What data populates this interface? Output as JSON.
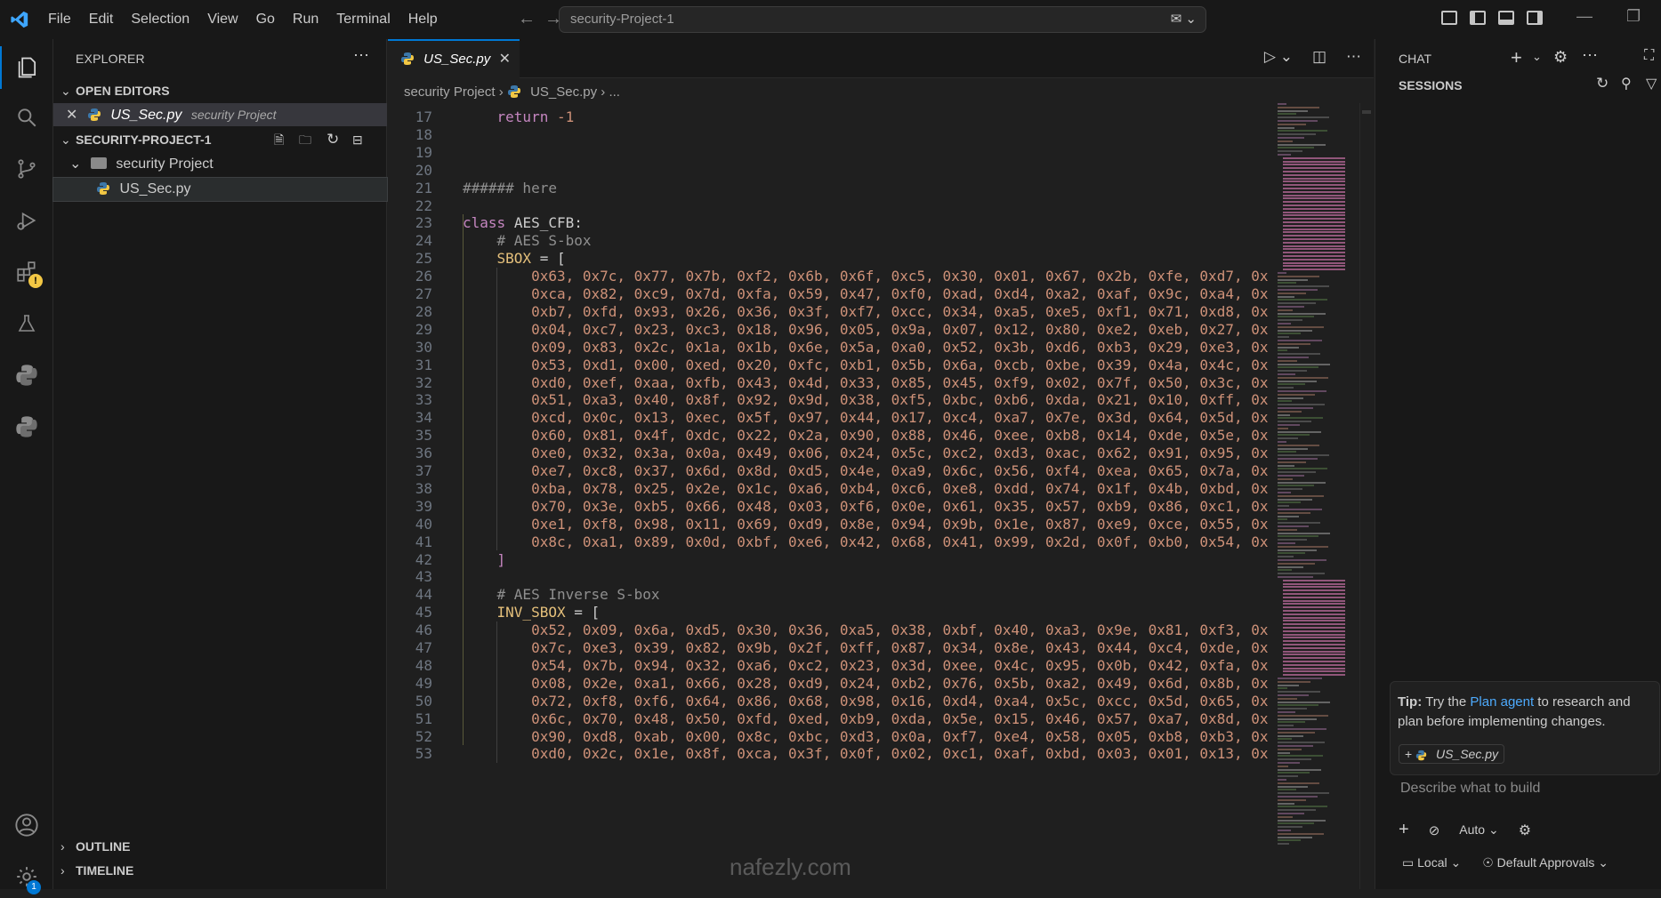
{
  "menu": [
    "File",
    "Edit",
    "Selection",
    "View",
    "Go",
    "Run",
    "Terminal",
    "Help"
  ],
  "command_center": "security-Project-1",
  "explorer": {
    "title": "EXPLORER",
    "open_editors_label": "OPEN EDITORS",
    "open_editor_file": "US_Sec.py",
    "open_editor_folder": "security Project",
    "project_label": "SECURITY-PROJECT-1",
    "folder_name": "security Project",
    "file_name": "US_Sec.py",
    "outline_label": "OUTLINE",
    "timeline_label": "TIMELINE"
  },
  "editor": {
    "tab_label": "US_Sec.py",
    "breadcrumb_folder": "security Project",
    "breadcrumb_file": "US_Sec.py",
    "breadcrumb_more": "...",
    "lines": [
      {
        "n": "17",
        "t": "return_neg"
      },
      {
        "n": "18",
        "t": "blank"
      },
      {
        "n": "19",
        "t": "blank"
      },
      {
        "n": "20",
        "t": "blank"
      },
      {
        "n": "21",
        "t": "comment_here"
      },
      {
        "n": "22",
        "t": "blank"
      },
      {
        "n": "23",
        "t": "class"
      },
      {
        "n": "24",
        "t": "comment_sbox"
      },
      {
        "n": "25",
        "t": "sbox_open"
      },
      {
        "n": "26",
        "t": "hex",
        "v": "0x63, 0x7c, 0x77, 0x7b, 0xf2, 0x6b, 0x6f, 0xc5, 0x30, 0x01, 0x67, 0x2b, 0xfe, 0xd7, 0x"
      },
      {
        "n": "27",
        "t": "hex",
        "v": "0xca, 0x82, 0xc9, 0x7d, 0xfa, 0x59, 0x47, 0xf0, 0xad, 0xd4, 0xa2, 0xaf, 0x9c, 0xa4, 0x"
      },
      {
        "n": "28",
        "t": "hex",
        "v": "0xb7, 0xfd, 0x93, 0x26, 0x36, 0x3f, 0xf7, 0xcc, 0x34, 0xa5, 0xe5, 0xf1, 0x71, 0xd8, 0x"
      },
      {
        "n": "29",
        "t": "hex",
        "v": "0x04, 0xc7, 0x23, 0xc3, 0x18, 0x96, 0x05, 0x9a, 0x07, 0x12, 0x80, 0xe2, 0xeb, 0x27, 0x"
      },
      {
        "n": "30",
        "t": "hex",
        "v": "0x09, 0x83, 0x2c, 0x1a, 0x1b, 0x6e, 0x5a, 0xa0, 0x52, 0x3b, 0xd6, 0xb3, 0x29, 0xe3, 0x"
      },
      {
        "n": "31",
        "t": "hex",
        "v": "0x53, 0xd1, 0x00, 0xed, 0x20, 0xfc, 0xb1, 0x5b, 0x6a, 0xcb, 0xbe, 0x39, 0x4a, 0x4c, 0x"
      },
      {
        "n": "32",
        "t": "hex",
        "v": "0xd0, 0xef, 0xaa, 0xfb, 0x43, 0x4d, 0x33, 0x85, 0x45, 0xf9, 0x02, 0x7f, 0x50, 0x3c, 0x"
      },
      {
        "n": "33",
        "t": "hex",
        "v": "0x51, 0xa3, 0x40, 0x8f, 0x92, 0x9d, 0x38, 0xf5, 0xbc, 0xb6, 0xda, 0x21, 0x10, 0xff, 0x"
      },
      {
        "n": "34",
        "t": "hex",
        "v": "0xcd, 0x0c, 0x13, 0xec, 0x5f, 0x97, 0x44, 0x17, 0xc4, 0xa7, 0x7e, 0x3d, 0x64, 0x5d, 0x"
      },
      {
        "n": "35",
        "t": "hex",
        "v": "0x60, 0x81, 0x4f, 0xdc, 0x22, 0x2a, 0x90, 0x88, 0x46, 0xee, 0xb8, 0x14, 0xde, 0x5e, 0x"
      },
      {
        "n": "36",
        "t": "hex",
        "v": "0xe0, 0x32, 0x3a, 0x0a, 0x49, 0x06, 0x24, 0x5c, 0xc2, 0xd3, 0xac, 0x62, 0x91, 0x95, 0x"
      },
      {
        "n": "37",
        "t": "hex",
        "v": "0xe7, 0xc8, 0x37, 0x6d, 0x8d, 0xd5, 0x4e, 0xa9, 0x6c, 0x56, 0xf4, 0xea, 0x65, 0x7a, 0x"
      },
      {
        "n": "38",
        "t": "hex",
        "v": "0xba, 0x78, 0x25, 0x2e, 0x1c, 0xa6, 0xb4, 0xc6, 0xe8, 0xdd, 0x74, 0x1f, 0x4b, 0xbd, 0x"
      },
      {
        "n": "39",
        "t": "hex",
        "v": "0x70, 0x3e, 0xb5, 0x66, 0x48, 0x03, 0xf6, 0x0e, 0x61, 0x35, 0x57, 0xb9, 0x86, 0xc1, 0x"
      },
      {
        "n": "40",
        "t": "hex",
        "v": "0xe1, 0xf8, 0x98, 0x11, 0x69, 0xd9, 0x8e, 0x94, 0x9b, 0x1e, 0x87, 0xe9, 0xce, 0x55, 0x"
      },
      {
        "n": "41",
        "t": "hex",
        "v": "0x8c, 0xa1, 0x89, 0x0d, 0xbf, 0xe6, 0x42, 0x68, 0x41, 0x99, 0x2d, 0x0f, 0xb0, 0x54, 0x"
      },
      {
        "n": "42",
        "t": "close"
      },
      {
        "n": "43",
        "t": "blank"
      },
      {
        "n": "44",
        "t": "comment_inv"
      },
      {
        "n": "45",
        "t": "inv_open"
      },
      {
        "n": "46",
        "t": "hex",
        "v": "0x52, 0x09, 0x6a, 0xd5, 0x30, 0x36, 0xa5, 0x38, 0xbf, 0x40, 0xa3, 0x9e, 0x81, 0xf3, 0x"
      },
      {
        "n": "47",
        "t": "hex",
        "v": "0x7c, 0xe3, 0x39, 0x82, 0x9b, 0x2f, 0xff, 0x87, 0x34, 0x8e, 0x43, 0x44, 0xc4, 0xde, 0x"
      },
      {
        "n": "48",
        "t": "hex",
        "v": "0x54, 0x7b, 0x94, 0x32, 0xa6, 0xc2, 0x23, 0x3d, 0xee, 0x4c, 0x95, 0x0b, 0x42, 0xfa, 0x"
      },
      {
        "n": "49",
        "t": "hex",
        "v": "0x08, 0x2e, 0xa1, 0x66, 0x28, 0xd9, 0x24, 0xb2, 0x76, 0x5b, 0xa2, 0x49, 0x6d, 0x8b, 0x"
      },
      {
        "n": "50",
        "t": "hex",
        "v": "0x72, 0xf8, 0xf6, 0x64, 0x86, 0x68, 0x98, 0x16, 0xd4, 0xa4, 0x5c, 0xcc, 0x5d, 0x65, 0x"
      },
      {
        "n": "51",
        "t": "hex",
        "v": "0x6c, 0x70, 0x48, 0x50, 0xfd, 0xed, 0xb9, 0xda, 0x5e, 0x15, 0x46, 0x57, 0xa7, 0x8d, 0x"
      },
      {
        "n": "52",
        "t": "hex",
        "v": "0x90, 0xd8, 0xab, 0x00, 0x8c, 0xbc, 0xd3, 0x0a, 0xf7, 0xe4, 0x58, 0x05, 0xb8, 0xb3, 0x"
      },
      {
        "n": "53",
        "t": "hex",
        "v": "0xd0, 0x2c, 0x1e, 0x8f, 0xca, 0x3f, 0x0f, 0x02, 0xc1, 0xaf, 0xbd, 0x03, 0x01, 0x13, 0x"
      }
    ],
    "tokens": {
      "return_kw": "return",
      "neg_one": "-1",
      "comment_here": "###### here",
      "class_kw": "class",
      "class_name": "AES_CFB:",
      "comment_sbox": "# AES S-box",
      "sbox_name": "SBOX",
      "eq_bracket": " = [",
      "close_bracket": "]",
      "comment_inv": "# AES Inverse S-box",
      "inv_name": "INV_SBOX"
    }
  },
  "chat": {
    "title": "CHAT",
    "sessions_label": "SESSIONS",
    "tip_prefix": "Tip:",
    "tip_text_1": " Try the ",
    "tip_link": "Plan agent",
    "tip_text_2": " to research and plan before implementing changes.",
    "context_file": "US_Sec.py",
    "input_placeholder": "Describe what to build",
    "mode_label": "Auto",
    "location_label": "Local",
    "approvals_label": "Default Approvals"
  },
  "watermark": "nafezly.com",
  "colors": {
    "accent": "#0078d4",
    "warning_badge": "#f2c744",
    "notification_badge": "#0078d4"
  }
}
